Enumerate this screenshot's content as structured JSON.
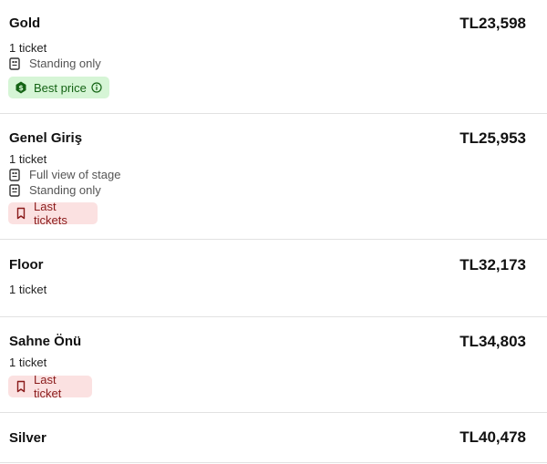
{
  "tickets": [
    {
      "name": "Gold",
      "price": "TL23,598",
      "quantity": "1 ticket",
      "features": [
        "Standing only"
      ],
      "badge": {
        "label": "Best price",
        "type": "best-price",
        "color": "#146314",
        "bg": "#d6f5d6",
        "icon": "dollar-badge-icon",
        "info_icon": "info-icon"
      }
    },
    {
      "name": "Genel Giriş",
      "price": "TL25,953",
      "quantity": "1 ticket",
      "features": [
        "Full view of stage",
        "Standing only"
      ],
      "badge": {
        "label": "Last tickets",
        "type": "scarcity",
        "color": "#8a1b1b",
        "bg": "#fbe1e1",
        "icon": "bookmark-icon"
      }
    },
    {
      "name": "Floor",
      "price": "TL32,173",
      "quantity": "1 ticket",
      "features": []
    },
    {
      "name": "Sahne Önü",
      "price": "TL34,803",
      "quantity": "1 ticket",
      "features": [],
      "badge": {
        "label": "Last ticket",
        "type": "scarcity",
        "color": "#8a1b1b",
        "bg": "#fbe1e1",
        "icon": "bookmark-icon"
      }
    },
    {
      "name": "Silver",
      "price": "TL40,478"
    }
  ]
}
